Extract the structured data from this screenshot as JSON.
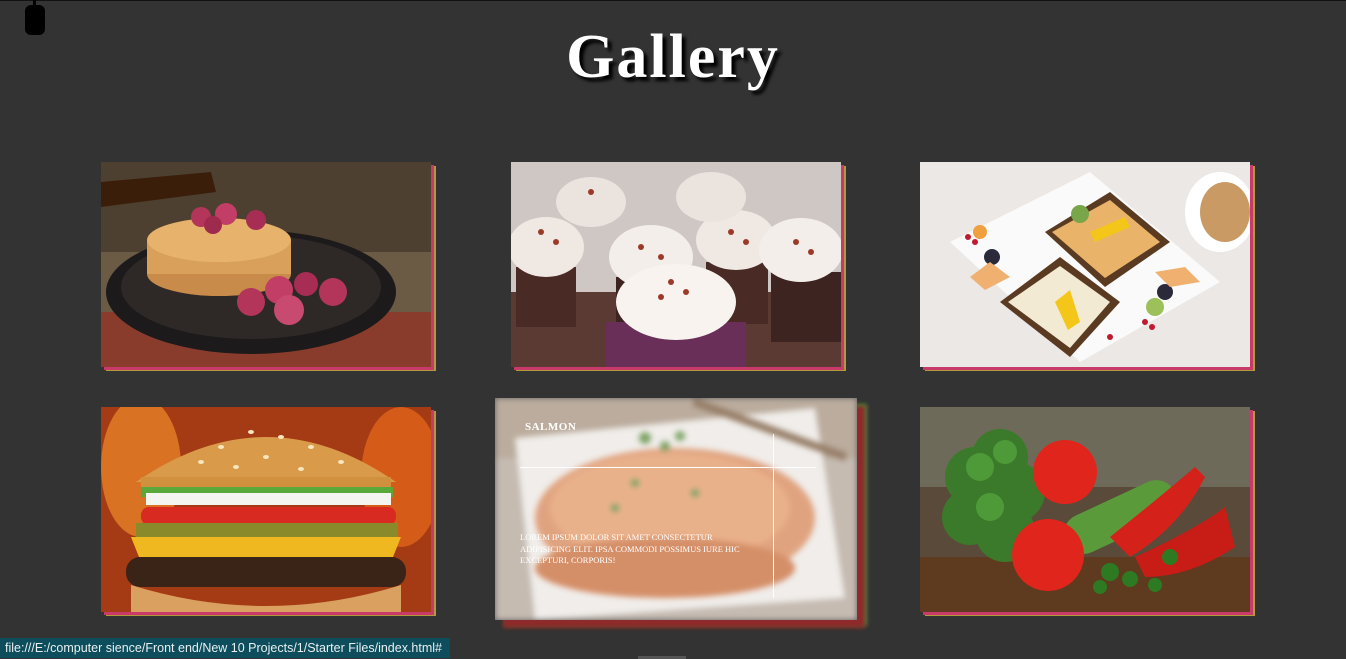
{
  "page": {
    "title": "Gallery"
  },
  "gallery": {
    "items": [
      {
        "name": "pancakes",
        "icon": "pancakes-image"
      },
      {
        "name": "cupcakes",
        "icon": "cupcakes-image"
      },
      {
        "name": "toast",
        "icon": "toast-image"
      },
      {
        "name": "burger",
        "icon": "burger-image"
      },
      {
        "name": "salmon",
        "icon": "salmon-image",
        "overlay_title": "SALMON",
        "overlay_text": "Lorem ipsum dolor sit amet consectetur adipisicing elit. Ipsa commodi possimus iure hic excepturi, corporis!"
      },
      {
        "name": "vegetables",
        "icon": "vegetables-image"
      }
    ]
  },
  "statusbar": {
    "url": "file:///E:/computer sience/Front end/New 10 Projects/1/Starter Files/index.html#"
  },
  "colors": {
    "background": "#333333",
    "status_bg": "#0d4d5c",
    "shadow_pink": "#c93a6a",
    "shadow_gold": "#b09a3a"
  }
}
